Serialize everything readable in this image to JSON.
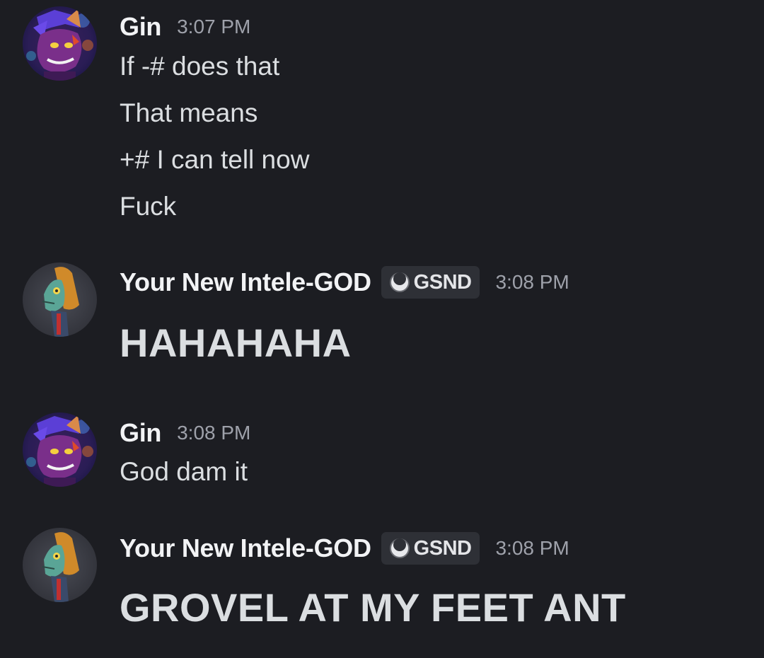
{
  "messages": [
    {
      "author": "Gin",
      "time": "3:07 PM",
      "lines": [
        "If -# does that",
        "That means",
        "+# I can tell now",
        "Fuck"
      ]
    },
    {
      "author": "Your New Intele-GOD",
      "tag": "GSND",
      "time": "3:08 PM",
      "big_text": "HAHAHAHA"
    },
    {
      "author": "Gin",
      "time": "3:08 PM",
      "lines": [
        "God dam it"
      ]
    },
    {
      "author": "Your New Intele-GOD",
      "tag": "GSND",
      "time": "3:08 PM",
      "big_text": "GROVEL AT MY FEET ANT"
    }
  ],
  "colors": {
    "background": "#1c1d22",
    "username": "#f2f3f5",
    "timestamp": "#9ea1aa",
    "message_text": "#dbdee1",
    "tag_background": "#2e3036"
  },
  "icons": {
    "tag_icon": "moon-orb-icon",
    "gin_avatar": "purple-wolf-avatar",
    "god_avatar": "lizard-hood-avatar"
  }
}
